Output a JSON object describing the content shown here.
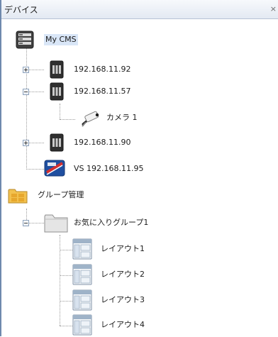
{
  "window": {
    "title": "デバイス",
    "close_label": "×"
  },
  "tree": {
    "root": {
      "label": "My CMS",
      "icon": "cms-server-icon"
    },
    "devices": [
      {
        "label": "192.168.11.92",
        "icon": "recorder-icon",
        "expander": "plus"
      },
      {
        "label": "192.168.11.57",
        "icon": "recorder-icon",
        "expander": "minus",
        "children": [
          {
            "label": "カメラ 1",
            "icon": "camera-icon"
          }
        ]
      },
      {
        "label": "192.168.11.90",
        "icon": "recorder-icon",
        "expander": "plus"
      },
      {
        "label": "VS 192.168.11.95",
        "icon": "video-server-icon"
      }
    ],
    "group_management": {
      "label": "グループ管理",
      "icon": "group-folder-icon"
    },
    "favorite_group": {
      "label": "お気に入りグループ1",
      "icon": "folder-icon",
      "expander": "minus",
      "layouts": [
        {
          "label": "レイアウト1",
          "icon": "layout-icon"
        },
        {
          "label": "レイアウト2",
          "icon": "layout-icon"
        },
        {
          "label": "レイアウト3",
          "icon": "layout-icon"
        },
        {
          "label": "レイアウト4",
          "icon": "layout-icon"
        }
      ]
    }
  },
  "colors": {
    "selected_bg": "#d9e6f7",
    "titlebar_border": "#b7c3d6",
    "tree_line": "#9a9a9a"
  }
}
